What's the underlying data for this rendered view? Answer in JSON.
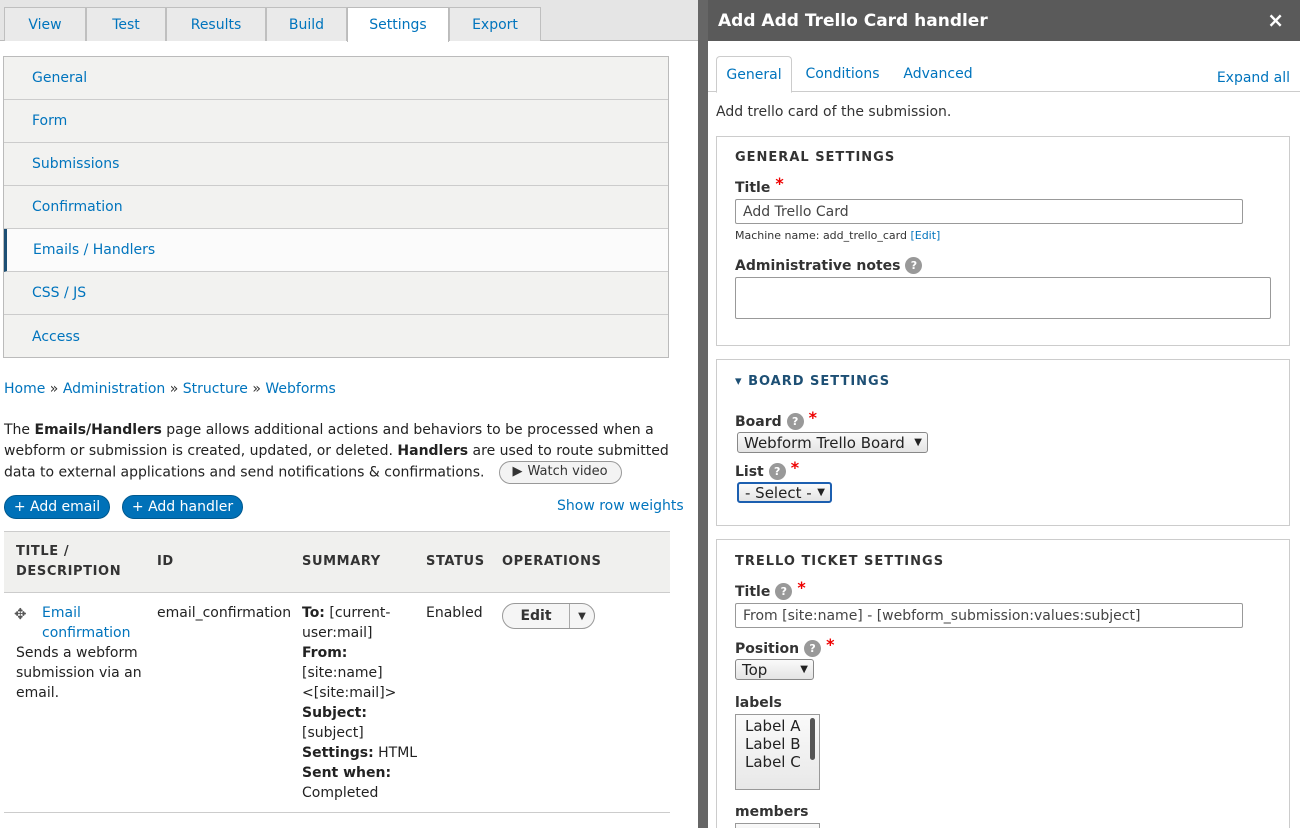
{
  "tabs": [
    "View",
    "Test",
    "Results",
    "Build",
    "Settings",
    "Export"
  ],
  "active_tab": "Settings",
  "vertical_menu": [
    "General",
    "Form",
    "Submissions",
    "Confirmation",
    "Emails / Handlers",
    "CSS / JS",
    "Access"
  ],
  "active_menu": "Emails / Handlers",
  "breadcrumb": {
    "items": [
      "Home",
      "Administration",
      "Structure",
      "Webforms"
    ],
    "separator": "»"
  },
  "description": {
    "p1": "The ",
    "b1": "Emails/Handlers",
    "p2": " page allows additional actions and behaviors to be processed when a webform or submission is created, updated, or deleted. ",
    "b2": "Handlers",
    "p3": " are used to route submitted data to external applications and send notifications & confirmations.",
    "watch_video": "Watch video"
  },
  "buttons": {
    "add_email": "+ Add email",
    "add_handler": "+ Add handler",
    "row_weights": "Show row weights"
  },
  "table": {
    "headers": {
      "title_line1": "TITLE /",
      "title_line2": "DESCRIPTION",
      "id": "ID",
      "summary": "SUMMARY",
      "status": "STATUS",
      "operations": "OPERATIONS"
    },
    "row": {
      "title_line1": "Email",
      "title_line2": "confirmation",
      "description": [
        "Sends a webform",
        "submission via an",
        "email."
      ],
      "id": "email_confirmation",
      "summary": [
        {
          "b": "To:",
          "t": " [current-"
        },
        {
          "b": "",
          "t": "user:mail]"
        },
        {
          "b": "From:",
          "t": ""
        },
        {
          "b": "",
          "t": "[site:name]"
        },
        {
          "b": "",
          "t": "<[site:mail]>"
        },
        {
          "b": "Subject:",
          "t": ""
        },
        {
          "b": "",
          "t": "[subject]"
        },
        {
          "b": "Settings:",
          "t": " HTML"
        },
        {
          "b": "Sent when:",
          "t": ""
        },
        {
          "b": "",
          "t": "Completed"
        }
      ],
      "status": "Enabled",
      "edit": "Edit"
    }
  },
  "dialog": {
    "title": "Add Add Trello Card handler",
    "close": "×",
    "tabs": [
      "General",
      "Conditions",
      "Advanced"
    ],
    "active_tab": "General",
    "expand_all": "Expand all",
    "intro": "Add trello card of the submission.",
    "general": {
      "legend": "GENERAL SETTINGS",
      "title_label": "Title",
      "title_value": "Add Trello Card",
      "machine_prefix": "Machine name: add_trello_card ",
      "machine_edit": "[Edit]",
      "notes_label": "Administrative notes"
    },
    "board": {
      "legend": "BOARD SETTINGS",
      "board_label": "Board",
      "board_value": "Webform Trello Board",
      "list_label": "List",
      "list_value": "- Select -"
    },
    "ticket": {
      "legend": "TRELLO TICKET SETTINGS",
      "title_label": "Title",
      "title_value": "From [site:name] - [webform_submission:values:subject]",
      "position_label": "Position",
      "position_value": "Top",
      "labels_label": "labels",
      "labels": [
        "Label A",
        "Label B",
        "Label C"
      ],
      "members_label": "members"
    }
  }
}
